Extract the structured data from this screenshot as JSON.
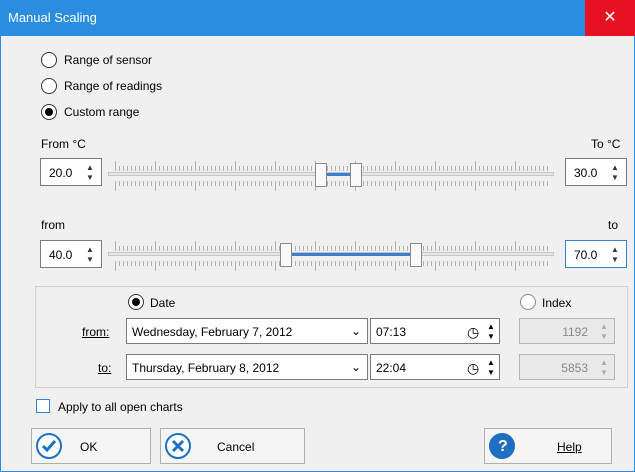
{
  "window": {
    "title": "Manual Scaling",
    "close_glyph": "✕",
    "accent": "#2b8de0",
    "close_bg": "#e81123"
  },
  "range_options": [
    {
      "label": "Range of sensor",
      "checked": false
    },
    {
      "label": "Range of readings",
      "checked": false
    },
    {
      "label": "Custom range",
      "checked": true
    }
  ],
  "temp": {
    "from_label": "From °C",
    "to_label": "To °C",
    "from_value": "20.0",
    "to_value": "30.0"
  },
  "percent": {
    "from_label": "from",
    "to_label": "to",
    "from_value": "40.0",
    "to_value": "70.0"
  },
  "time_range": {
    "date_label": "Date",
    "index_label": "Index",
    "date_checked": true,
    "from_label": "from:",
    "to_label": "to:",
    "from_date": "Wednesday, February 7, 2012",
    "to_date": "Thursday, February 8, 2012",
    "from_time": "07:13",
    "to_time": "22:04",
    "from_index": "1192",
    "to_index": "5853"
  },
  "apply_all": {
    "label": "Apply to all open charts",
    "checked": false
  },
  "buttons": {
    "ok": "OK",
    "cancel": "Cancel",
    "help": "Help"
  },
  "icons": {
    "ok": "check-circle-icon",
    "cancel": "x-circle-icon",
    "help": "question-circle-icon",
    "clock": "clock-icon",
    "dropdown": "chevron-down-icon"
  }
}
